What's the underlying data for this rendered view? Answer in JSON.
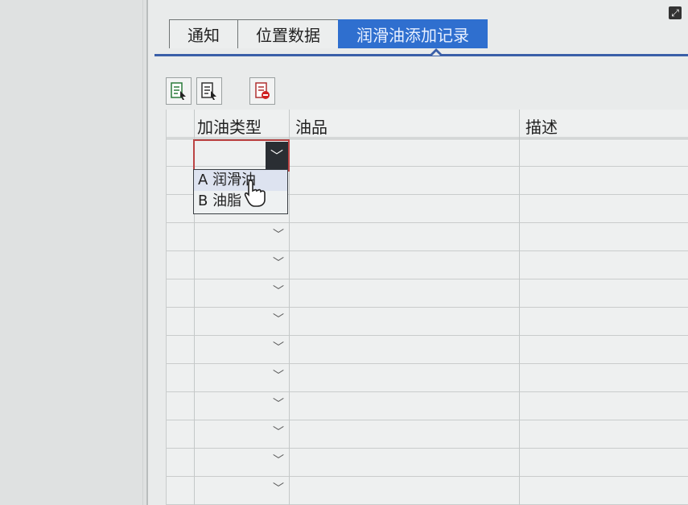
{
  "tabs": [
    {
      "label": "通知",
      "active": false
    },
    {
      "label": "位置数据",
      "active": false
    },
    {
      "label": "润滑油添加记录",
      "active": true
    }
  ],
  "toolbar": {
    "buttons": [
      {
        "icon": "add-row-icon"
      },
      {
        "icon": "insert-row-icon"
      },
      {
        "icon": "delete-row-icon"
      }
    ]
  },
  "table": {
    "columns": [
      "加油类型",
      "油品",
      "描述"
    ],
    "row_count": 13
  },
  "dropdown": {
    "options": [
      "A 润滑油",
      "B 油脂"
    ]
  },
  "colors": {
    "tab_active": "#2f6fcf",
    "tab_underline": "#3a5fa8",
    "cell_border_active": "#b44"
  },
  "window": {
    "icon": "maximize-icon"
  }
}
